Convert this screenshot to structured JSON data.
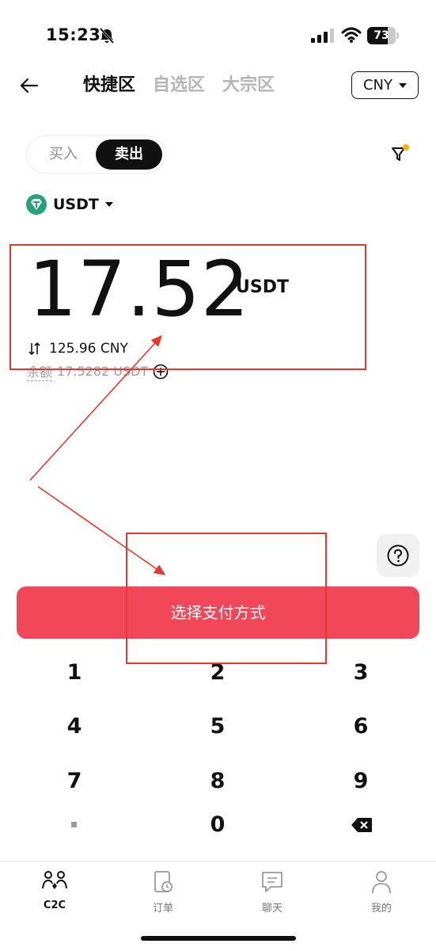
{
  "status_bar": {
    "time": "15:23",
    "battery": "73",
    "battery_level": 0.73
  },
  "header": {
    "tabs": [
      {
        "label": "快捷区",
        "active": true
      },
      {
        "label": "自选区",
        "active": false
      },
      {
        "label": "大宗区",
        "active": false
      }
    ],
    "currency": "CNY"
  },
  "trade_toggle": {
    "buy": "买入",
    "sell": "卖出",
    "selected": "sell"
  },
  "coin": {
    "label": "USDT"
  },
  "amount": {
    "value": "17.52",
    "unit": "USDT",
    "converted": "125.96 CNY",
    "balance_label": "余额",
    "balance_value": "17.5282 USDT"
  },
  "pay_button": {
    "label": "选择支付方式"
  },
  "keypad": {
    "keys": [
      "1",
      "2",
      "3",
      "4",
      "5",
      "6",
      "7",
      "8",
      "9",
      "0"
    ]
  },
  "bottom_nav": {
    "items": [
      {
        "label": "C2C",
        "icon": "c2c-icon",
        "active": true
      },
      {
        "label": "订单",
        "icon": "order-icon",
        "active": false
      },
      {
        "label": "聊天",
        "icon": "chat-icon",
        "active": false
      },
      {
        "label": "我的",
        "icon": "profile-icon",
        "active": false
      }
    ]
  },
  "colors": {
    "accent": "#f24659",
    "annotation": "#e8362c",
    "filter_dot": "#f5b300",
    "coin": "#26a17b"
  }
}
